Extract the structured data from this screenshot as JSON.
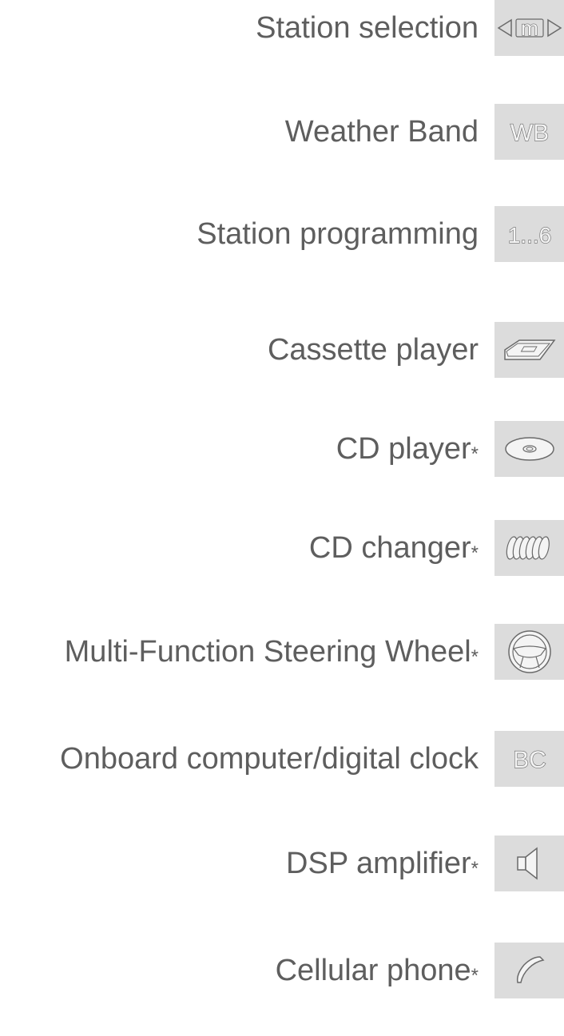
{
  "rows": [
    {
      "label": "Station selection",
      "asterisk": "",
      "icon": "station-selection-icon"
    },
    {
      "label": "Weather Band",
      "asterisk": "",
      "icon": "weather-band-icon",
      "icon_text": "WB"
    },
    {
      "label": "Station programming",
      "asterisk": "",
      "icon": "station-programming-icon",
      "icon_text": "1...6"
    },
    {
      "label": "Cassette player",
      "asterisk": "",
      "icon": "cassette-icon"
    },
    {
      "label": "CD player",
      "asterisk": "*",
      "icon": "cd-icon"
    },
    {
      "label": "CD changer",
      "asterisk": "*",
      "icon": "cd-changer-icon"
    },
    {
      "label": "Multi-Function Steering Wheel",
      "asterisk": "*",
      "icon": "steering-wheel-icon"
    },
    {
      "label": "Onboard computer/digital clock",
      "asterisk": "",
      "icon": "onboard-computer-icon",
      "icon_text": "BC"
    },
    {
      "label": "DSP amplifier",
      "asterisk": "*",
      "icon": "speaker-icon"
    },
    {
      "label": "Cellular phone",
      "asterisk": "*",
      "icon": "phone-icon"
    }
  ],
  "colors": {
    "text": "#5e5e5e",
    "tab_background": "#dcdcdc",
    "icon_stroke": "#6a6a6a"
  }
}
